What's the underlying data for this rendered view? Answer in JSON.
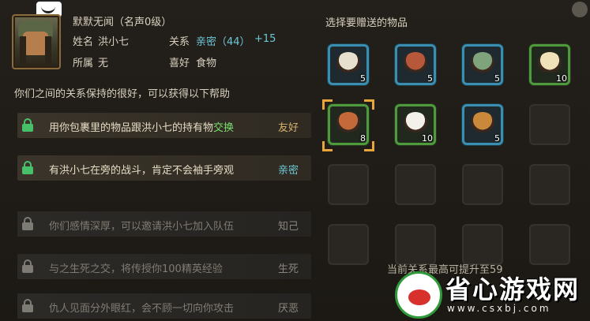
{
  "npc": {
    "title": "默默无闻（名声0级）",
    "name_label": "姓名",
    "name": "洪小七",
    "relation_label": "关系",
    "relation_value": "亲密（44）",
    "relation_bonus": "+15",
    "faction_label": "所属",
    "faction": "无",
    "hobby_label": "喜好",
    "hobby": "食物"
  },
  "relation_desc": "你们之间的关系保持的很好，可以获得以下帮助",
  "benefits": [
    {
      "text_before": "用你包裹里的物品跟洪小七的持有物",
      "text_highlight": "交换",
      "level": "友好",
      "unlocked": true,
      "level_color": "#d7b26a"
    },
    {
      "text_before": "有洪小七在旁的战斗，肯定不会袖手旁观",
      "text_highlight": "",
      "level": "亲密",
      "unlocked": true,
      "level_color": "#6cc7d6"
    },
    {
      "text_before": "你们感情深厚，可以邀请洪小七加入队伍",
      "text_highlight": "",
      "level": "知己",
      "unlocked": false,
      "level_color": "#8a857d"
    },
    {
      "text_before": "与之生死之交，将传授你100精英经验",
      "text_highlight": "",
      "level": "生死",
      "unlocked": false,
      "level_color": "#8a857d"
    },
    {
      "text_before": "仇人见面分外眼红，会不顾一切向你攻击",
      "text_highlight": "",
      "level": "厌恶",
      "unlocked": false,
      "level_color": "#8a857d"
    }
  ],
  "gift_panel": {
    "title": "选择要赠送的物品",
    "items": [
      {
        "name": "egg-noodle-bowl",
        "count": "5",
        "frame": "blue",
        "color": "#e8e0cf"
      },
      {
        "name": "meat-stew-bowl",
        "count": "5",
        "frame": "blue",
        "color": "#b8583a"
      },
      {
        "name": "vegetable-soup-bowl",
        "count": "5",
        "frame": "blue",
        "color": "#7fa37a"
      },
      {
        "name": "steamed-buns",
        "count": "10",
        "frame": "green",
        "color": "#efe2b8"
      },
      {
        "name": "fried-dish-plate",
        "count": "8",
        "frame": "green",
        "color": "#c46a3a"
      },
      {
        "name": "rice-bowl",
        "count": "10",
        "frame": "green",
        "color": "#f4f1ea"
      },
      {
        "name": "skewer-plate",
        "count": "5",
        "frame": "blue",
        "color": "#c9883a"
      },
      {
        "name": "",
        "count": "",
        "frame": "empty",
        "color": ""
      }
    ],
    "footer": "当前关系最高可提升至59"
  },
  "watermark": {
    "text": "省心游戏网",
    "url": "www.csxbj.com"
  },
  "colors": {
    "accent_cyan": "#6cc7d6",
    "accent_green": "#7be06d",
    "lock_green": "#48c06a",
    "gold": "#e7a63b"
  }
}
